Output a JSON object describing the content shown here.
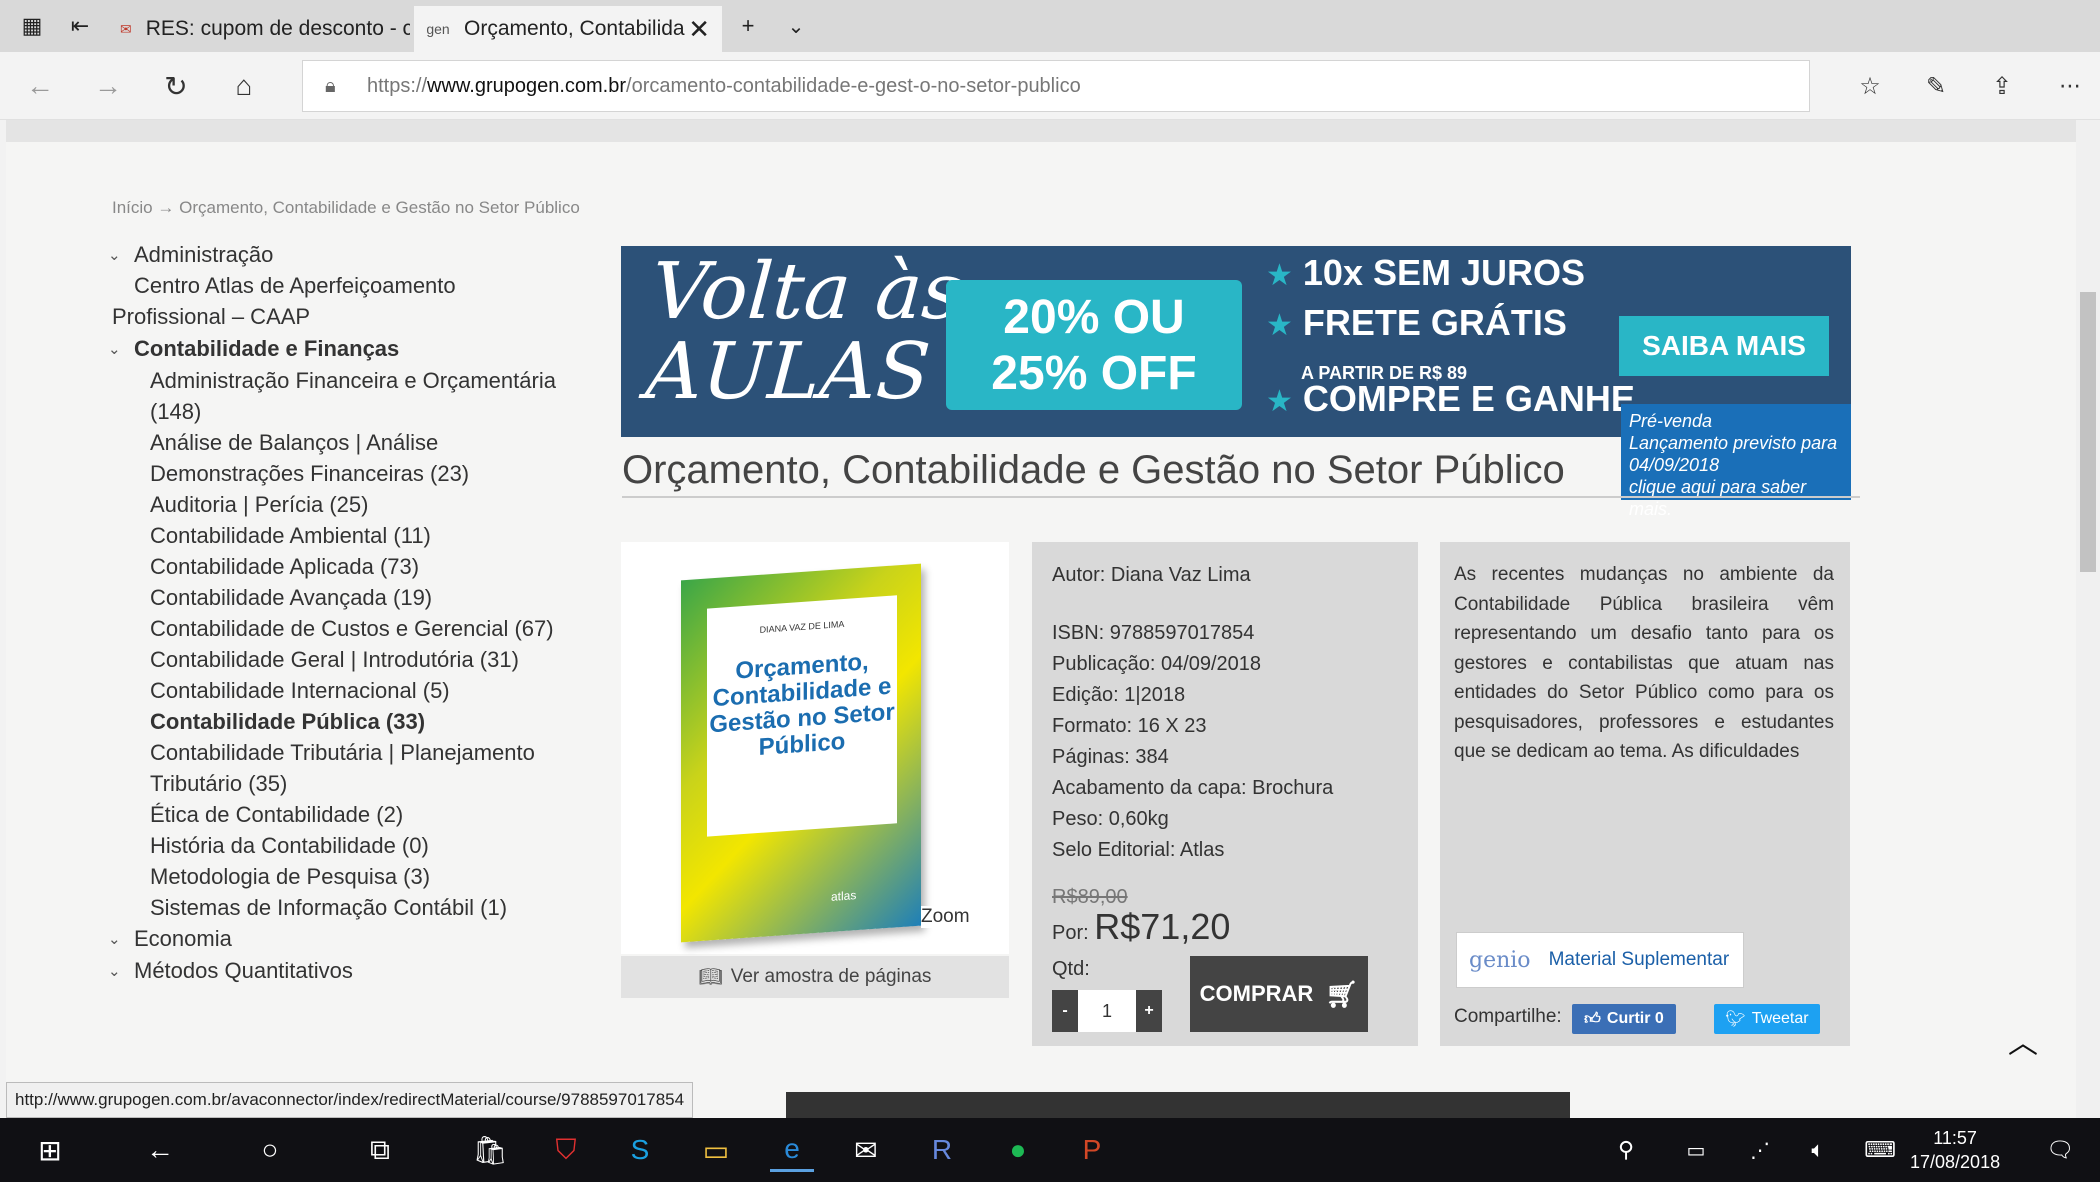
{
  "tabs": [
    {
      "title": "RES: cupom de desconto - c",
      "active": false
    },
    {
      "title": "Orçamento, Contabilida",
      "active": true
    }
  ],
  "nav": {
    "url_scheme": "https://",
    "url_host": "www.grupogen.com.br",
    "url_path": "/orcamento-contabilidade-e-gest-o-no-setor-publico"
  },
  "breadcrumb": {
    "home": "Início",
    "separator": "→",
    "current": "Orçamento, Contabilidade e Gestão no Setor Público"
  },
  "sidebar": {
    "cat1": "Administração",
    "cat1_sub1": "Centro Atlas de Aperfeiçoamento",
    "cat1_sub1b": "Profissional – CAAP",
    "cat2": "Contabilidade e Finanças",
    "items": [
      "Administração Financeira e Orçamentária",
      "(148)",
      "Análise de Balanços | Análise",
      "Demonstrações Financeiras (23)",
      "Auditoria | Perícia (25)",
      "Contabilidade Ambiental (11)",
      "Contabilidade Aplicada (73)",
      "Contabilidade Avançada (19)",
      "Contabilidade de Custos e Gerencial (67)",
      "Contabilidade Geral | Introdutória (31)",
      "Contabilidade Internacional (5)",
      "Contabilidade Pública (33)",
      "Contabilidade Tributária | Planejamento",
      "Tributário (35)",
      "Ética de Contabilidade (2)",
      "História da Contabilidade (0)",
      "Metodologia de Pesquisa (3)",
      "Sistemas de Informação Contábil (1)"
    ],
    "cat3": "Economia",
    "cat4": "Métodos Quantitativos"
  },
  "banner": {
    "headline1": "Volta às",
    "headline2": "AULAS",
    "discount1": "20% OU",
    "discount2": "25% OFF",
    "feature1": "10x SEM JUROS",
    "feature2": "FRETE GRÁTIS",
    "feature2_sub": "A PARTIR DE R$ 89",
    "feature3": "COMPRE E GANHE",
    "cta": "SAIBA MAIS"
  },
  "prevenda": {
    "l1": "Pré-venda",
    "l2": "Lançamento previsto para",
    "l3": "04/09/2018",
    "l4": "clique aqui para saber mais."
  },
  "product": {
    "title": "Orçamento, Contabilidade e Gestão no Setor Público",
    "cover_author": "DIANA VAZ DE LIMA",
    "cover_title": "Orçamento, Contabilidade e Gestão no Setor Público",
    "cover_publisher": "atlas",
    "zoom": "Zoom",
    "sample": "Ver amostra de páginas",
    "author": "Autor: Diana Vaz Lima",
    "isbn": "ISBN: 9788597017854",
    "publicacao": "Publicação: 04/09/2018",
    "edicao": "Edição: 1|2018",
    "formato": "Formato: 16 X 23",
    "paginas": "Páginas: 384",
    "acabamento": "Acabamento da capa: Brochura",
    "peso": "Peso: 0,60kg",
    "selo": "Selo Editorial: Atlas",
    "old_price": "R$89,00",
    "por": "Por:",
    "price": "R$71,20",
    "qtd_label": "Qtd:",
    "qty_minus": "-",
    "qty_value": "1",
    "qty_plus": "+",
    "buy": "COMPRAR",
    "description": "As recentes mudanças no ambiente da Contabilidade Pública brasileira vêm representando um desafio tanto para os gestores e contabilistas que atuam nas entidades do Setor Público como para os pesquisadores, professores e estudantes que se dedicam ao tema. As dificuldades",
    "genio_logo": "genio",
    "material": "Material Suplementar",
    "share": "Compartilhe:",
    "fb": "Curtir 0",
    "tweet": "Tweetar"
  },
  "status_url": "http://www.grupogen.com.br/avaconnector/index/redirectMaterial/course/9788597017854",
  "taskbar": {
    "time": "11:57",
    "date": "17/08/2018"
  }
}
